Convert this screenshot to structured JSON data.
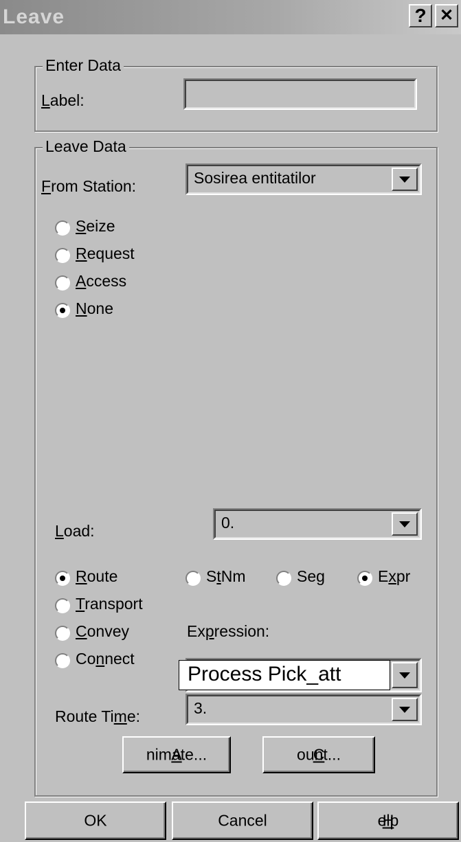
{
  "window": {
    "title": "Leave",
    "help_glyph": "?",
    "close_glyph": "✕"
  },
  "enter_data": {
    "legend": "Enter Data",
    "label_prefix": "",
    "label_hot": "L",
    "label_rest": "abel:",
    "label_value": ""
  },
  "leave_data": {
    "legend": "Leave Data",
    "from_station": {
      "hot": "F",
      "rest": "rom Station:",
      "value": "Sosirea entitatilor"
    },
    "radios": [
      {
        "hot": "S",
        "rest": "eize",
        "checked": false
      },
      {
        "hot": "R",
        "rest": "equest",
        "checked": false
      },
      {
        "hot": "A",
        "rest": "ccess",
        "checked": false
      },
      {
        "hot": "N",
        "rest": "one",
        "checked": true
      }
    ],
    "load": {
      "hot": "L",
      "rest": "oad:",
      "value": "0."
    },
    "mode_radios": [
      {
        "hot": "R",
        "rest": "oute",
        "checked": true
      },
      {
        "hot": "T",
        "rest": "ransport",
        "checked": false
      },
      {
        "hot": "C",
        "rest": "onvey",
        "checked": false
      },
      {
        "pre": "Co",
        "hot": "n",
        "rest": "nect",
        "checked": false
      }
    ],
    "dest_radios": [
      {
        "pre": "S",
        "hot": "t",
        "rest": "Nm",
        "checked": false
      },
      {
        "pre": "Se",
        "hot": "g",
        "rest": "",
        "checked": false
      },
      {
        "pre": "E",
        "hot": "x",
        "rest": "pr",
        "checked": true
      }
    ],
    "expression": {
      "pre": "Ex",
      "hot": "p",
      "rest": "ression:",
      "value": "Process Pick_att"
    },
    "route_time": {
      "pre": "Route Ti",
      "hot": "m",
      "rest": "e:",
      "value": "3."
    },
    "animate_button": {
      "hot": "A",
      "rest": "nimate..."
    },
    "count_button": {
      "hot": "C",
      "rest": "ount..."
    }
  },
  "footer": {
    "ok": "OK",
    "cancel": "Cancel",
    "help_hot": "H",
    "help_rest": "elp"
  }
}
